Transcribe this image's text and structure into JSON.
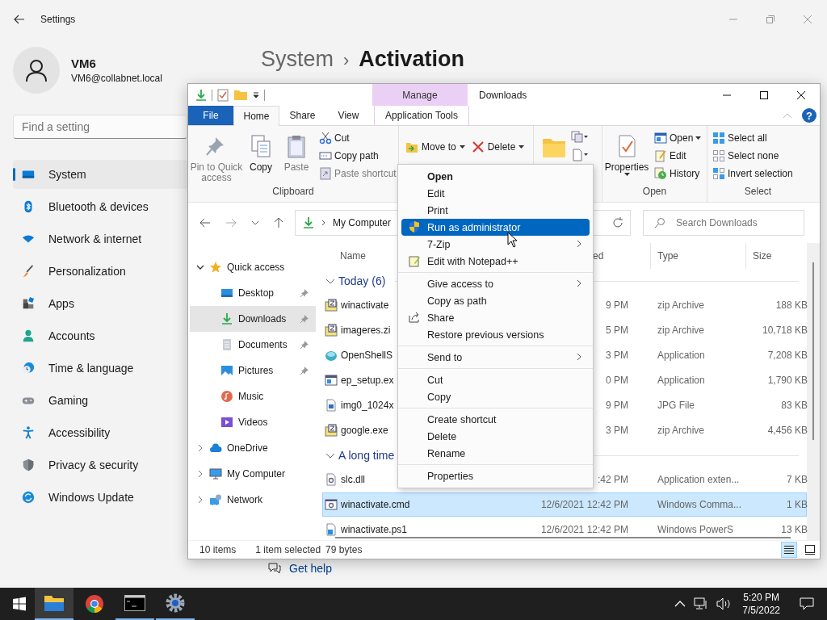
{
  "settings": {
    "title": "Settings",
    "user": {
      "name": "VM6",
      "email": "VM6@collabnet.local"
    },
    "search": {
      "placeholder": "Find a setting"
    },
    "nav": [
      {
        "label": "System",
        "selected": true
      },
      {
        "label": "Bluetooth & devices",
        "selected": false
      },
      {
        "label": "Network & internet",
        "selected": false
      },
      {
        "label": "Personalization",
        "selected": false
      },
      {
        "label": "Apps",
        "selected": false
      },
      {
        "label": "Accounts",
        "selected": false
      },
      {
        "label": "Time & language",
        "selected": false
      },
      {
        "label": "Gaming",
        "selected": false
      },
      {
        "label": "Accessibility",
        "selected": false
      },
      {
        "label": "Privacy & security",
        "selected": false
      },
      {
        "label": "Windows Update",
        "selected": false
      }
    ],
    "breadcrumb": {
      "parent": "System",
      "separator": "›",
      "current": "Activation"
    },
    "help_link": "Get help"
  },
  "explorer": {
    "title": "Downloads",
    "tool_group": "Manage",
    "help_button": "?",
    "tabs": [
      {
        "label": "File",
        "kind": "file",
        "selected": false
      },
      {
        "label": "Home",
        "kind": "tab",
        "selected": true
      },
      {
        "label": "Share",
        "kind": "tab",
        "selected": false
      },
      {
        "label": "View",
        "kind": "tab",
        "selected": false
      },
      {
        "label": "Application Tools",
        "kind": "contextual",
        "selected": false
      }
    ],
    "ribbon": {
      "clipboard": {
        "label": "Clipboard",
        "large": [
          {
            "label": "Pin to Quick access",
            "disabled": true
          },
          {
            "label": "Copy",
            "disabled": false
          },
          {
            "label": "Paste",
            "disabled": true
          }
        ],
        "small": [
          {
            "label": "Cut",
            "disabled": false
          },
          {
            "label": "Copy path",
            "disabled": false
          },
          {
            "label": "Paste shortcut",
            "disabled": true
          }
        ]
      },
      "organize": {
        "buttons": [
          {
            "label": "Move to",
            "dropdown": true
          },
          {
            "label": "Delete",
            "dropdown": true
          }
        ]
      },
      "open": {
        "label": "Open",
        "large": {
          "label": "Properties",
          "dropdown": true
        },
        "small": [
          {
            "label": "Open",
            "dropdown": true
          },
          {
            "label": "Edit",
            "dropdown": false
          },
          {
            "label": "History",
            "dropdown": false
          }
        ]
      },
      "select": {
        "label": "Select",
        "small": [
          {
            "label": "Select all"
          },
          {
            "label": "Select none"
          },
          {
            "label": "Invert selection"
          }
        ]
      }
    },
    "address": {
      "path": "My Computer"
    },
    "search": {
      "placeholder": "Search Downloads"
    },
    "nav": [
      {
        "label": "Quick access",
        "expanded": true,
        "children": [
          {
            "label": "Desktop",
            "pinned": true,
            "selected": false
          },
          {
            "label": "Downloads",
            "pinned": true,
            "selected": true
          },
          {
            "label": "Documents",
            "pinned": true,
            "selected": false
          },
          {
            "label": "Pictures",
            "pinned": true,
            "selected": false
          },
          {
            "label": "Music",
            "pinned": false,
            "selected": false
          },
          {
            "label": "Videos",
            "pinned": false,
            "selected": false
          }
        ]
      },
      {
        "label": "OneDrive",
        "expanded": false
      },
      {
        "label": "My Computer",
        "expanded": false
      },
      {
        "label": "Network",
        "expanded": false
      }
    ],
    "columns": [
      "Name",
      "ed",
      "Type",
      "Size"
    ],
    "groups": [
      {
        "label": "Today (6)",
        "expanded": true,
        "rows": [
          {
            "name": "winactivate",
            "modified": "9 PM",
            "type": "zip Archive",
            "size": "188 KB",
            "selected": false
          },
          {
            "name": "imageres.zi",
            "modified": "5 PM",
            "type": "zip Archive",
            "size": "10,718 KB",
            "selected": false
          },
          {
            "name": "OpenShellS",
            "modified": "3 PM",
            "type": "Application",
            "size": "7,208 KB",
            "selected": false
          },
          {
            "name": "ep_setup.ex",
            "modified": "0 PM",
            "type": "Application",
            "size": "1,790 KB",
            "selected": false
          },
          {
            "name": "img0_1024x",
            "modified": "9 PM",
            "type": "JPG File",
            "size": "83 KB",
            "selected": false
          },
          {
            "name": "google.exe",
            "modified": "3 PM",
            "type": "zip Archive",
            "size": "4,456 KB",
            "selected": false
          }
        ]
      },
      {
        "label": "A long time",
        "expanded": true,
        "rows": [
          {
            "name": "slc.dll",
            "modified": ":42 PM",
            "type": "Application exten...",
            "size": "7 KB",
            "selected": false
          },
          {
            "name": "winactivate.cmd",
            "modified": "12/6/2021 12:42 PM",
            "type": "Windows Comma...",
            "size": "1 KB",
            "selected": true
          },
          {
            "name": "winactivate.ps1",
            "modified": "12/6/2021 12:42 PM",
            "type": "Windows PowerS",
            "size": "13 KB",
            "selected": false
          }
        ]
      }
    ],
    "status": {
      "count": "10 items",
      "selection": "1 item selected",
      "size": "79 bytes"
    },
    "views": [
      {
        "selected": true
      },
      {
        "selected": false
      }
    ]
  },
  "context_menu": {
    "items": [
      {
        "kind": "item",
        "label": "Open",
        "default": true,
        "submenu": false,
        "selected": false
      },
      {
        "kind": "item",
        "label": "Edit",
        "default": false,
        "submenu": false,
        "selected": false
      },
      {
        "kind": "item",
        "label": "Print",
        "default": false,
        "submenu": false,
        "selected": false
      },
      {
        "kind": "item",
        "label": "Run as administrator",
        "default": false,
        "submenu": false,
        "selected": true
      },
      {
        "kind": "item",
        "label": "7-Zip",
        "default": false,
        "submenu": true,
        "selected": false
      },
      {
        "kind": "item",
        "label": "Edit with Notepad++",
        "default": false,
        "submenu": false,
        "selected": false
      },
      {
        "kind": "separator"
      },
      {
        "kind": "item",
        "label": "Give access to",
        "default": false,
        "submenu": true,
        "selected": false
      },
      {
        "kind": "item",
        "label": "Copy as path",
        "default": false,
        "submenu": false,
        "selected": false
      },
      {
        "kind": "item",
        "label": "Share",
        "default": false,
        "submenu": false,
        "selected": false
      },
      {
        "kind": "item",
        "label": "Restore previous versions",
        "default": false,
        "submenu": false,
        "selected": false
      },
      {
        "kind": "separator"
      },
      {
        "kind": "item",
        "label": "Send to",
        "default": false,
        "submenu": true,
        "selected": false
      },
      {
        "kind": "separator"
      },
      {
        "kind": "item",
        "label": "Cut",
        "default": false,
        "submenu": false,
        "selected": false
      },
      {
        "kind": "item",
        "label": "Copy",
        "default": false,
        "submenu": false,
        "selected": false
      },
      {
        "kind": "separator"
      },
      {
        "kind": "item",
        "label": "Create shortcut",
        "default": false,
        "submenu": false,
        "selected": false
      },
      {
        "kind": "item",
        "label": "Delete",
        "default": false,
        "submenu": false,
        "selected": false
      },
      {
        "kind": "item",
        "label": "Rename",
        "default": false,
        "submenu": false,
        "selected": false
      },
      {
        "kind": "separator"
      },
      {
        "kind": "item",
        "label": "Properties",
        "default": false,
        "submenu": false,
        "selected": false
      }
    ]
  },
  "taskbar": {
    "apps": [
      {
        "selected": true,
        "running": true
      },
      {
        "selected": false,
        "running": false
      },
      {
        "selected": false,
        "running": true
      },
      {
        "selected": false,
        "running": true
      }
    ],
    "time": "5:20 PM",
    "date": "7/5/2022"
  }
}
